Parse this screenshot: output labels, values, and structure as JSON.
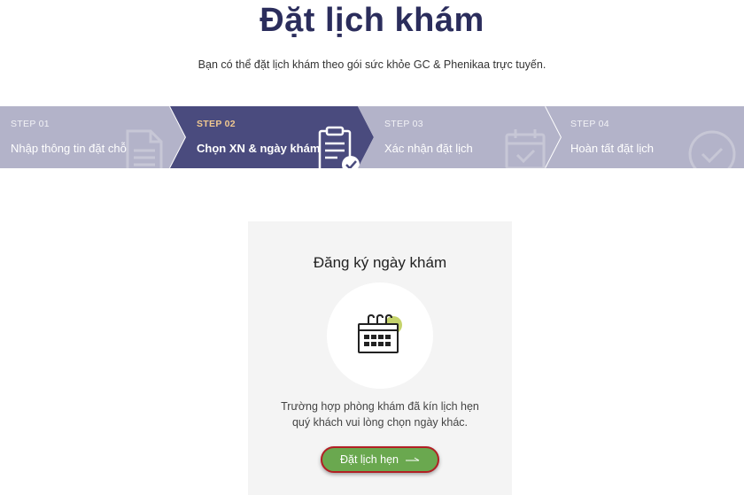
{
  "page": {
    "title": "Đặt lịch khám",
    "subtitle": "Bạn có thể đặt lịch khám theo gói sức khỏe GC & Phenikaa trực tuyến."
  },
  "steps": [
    {
      "number": "STEP 01",
      "label": "Nhập thông tin đặt chỗ",
      "icon": "document-icon",
      "active": false
    },
    {
      "number": "STEP 02",
      "label": "Chọn XN & ngày khám",
      "icon": "clipboard-check-icon",
      "active": true
    },
    {
      "number": "STEP 03",
      "label": "Xác nhận đặt lịch",
      "icon": "calendar-check-icon",
      "active": false
    },
    {
      "number": "STEP 04",
      "label": "Hoàn tất đặt lịch",
      "icon": "check-circle-icon",
      "active": false
    }
  ],
  "card": {
    "title": "Đăng ký ngày khám",
    "icon": "calendar-icon",
    "note_line1": "Trường hợp phòng khám đã kín lịch hẹn",
    "note_line2": "quý khách vui lòng chọn ngày khác.",
    "button_label": "Đặt lịch hẹn",
    "button_icon": "arrow-right-icon"
  },
  "colors": {
    "title": "#2b2d5c",
    "step_inactive": "#b3b3c9",
    "step_active": "#4a4b7e",
    "button": "#6aa84f",
    "button_border": "#b21f24",
    "calendar_accent": "#c5d36b"
  }
}
